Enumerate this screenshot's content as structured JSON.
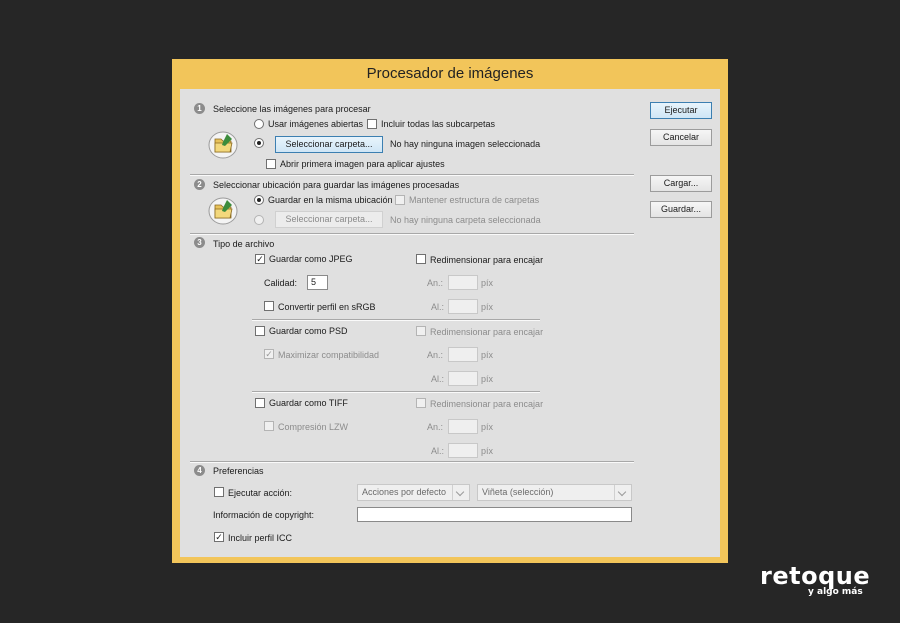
{
  "dialog": {
    "title": "Procesador de imágenes"
  },
  "buttons": {
    "run": "Ejecutar",
    "cancel": "Cancelar",
    "load": "Cargar...",
    "save": "Guardar..."
  },
  "section1": {
    "number": "1",
    "heading": "Seleccione las imágenes para procesar",
    "use_open_images": "Usar imágenes abiertas",
    "include_subfolders": "Incluir todas las subcarpetas",
    "select_folder_button": "Seleccionar carpeta...",
    "status": "No hay ninguna imagen seleccionada",
    "open_first_image": "Abrir primera imagen para aplicar ajustes"
  },
  "section2": {
    "number": "2",
    "heading": "Seleccionar ubicación para guardar las imágenes procesadas",
    "save_same_location": "Guardar en la misma ubicación",
    "keep_structure": "Mantener estructura de carpetas",
    "select_folder_button": "Seleccionar carpeta...",
    "status": "No hay ninguna carpeta seleccionada"
  },
  "section3": {
    "number": "3",
    "heading": "Tipo de archivo",
    "jpeg": {
      "save_as": "Guardar como JPEG",
      "resize": "Redimensionar para encajar",
      "quality_label": "Calidad:",
      "quality_value": "5",
      "convert_srgb": "Convertir perfil en sRGB",
      "width_label": "An.:",
      "height_label": "Al.:",
      "unit": "píx"
    },
    "psd": {
      "save_as": "Guardar como PSD",
      "resize": "Redimensionar para encajar",
      "maximize": "Maximizar compatibilidad",
      "width_label": "An.:",
      "height_label": "Al.:",
      "unit": "píx"
    },
    "tiff": {
      "save_as": "Guardar como TIFF",
      "resize": "Redimensionar para encajar",
      "compression": "Compresión LZW",
      "width_label": "An.:",
      "height_label": "Al.:",
      "unit": "píx"
    }
  },
  "section4": {
    "number": "4",
    "heading": "Preferencias",
    "run_action": "Ejecutar acción:",
    "action_set": "Acciones por defecto",
    "action_name": "Viñeta (selección)",
    "copyright_label": "Información de copyright:",
    "copyright_value": "",
    "include_icc": "Incluir perfil ICC"
  },
  "watermark": {
    "main": "retoque",
    "sub": "y algo más"
  },
  "colors": {
    "title_bar": "#f2c55a",
    "background": "#262626",
    "panel": "#e0e0e0"
  }
}
